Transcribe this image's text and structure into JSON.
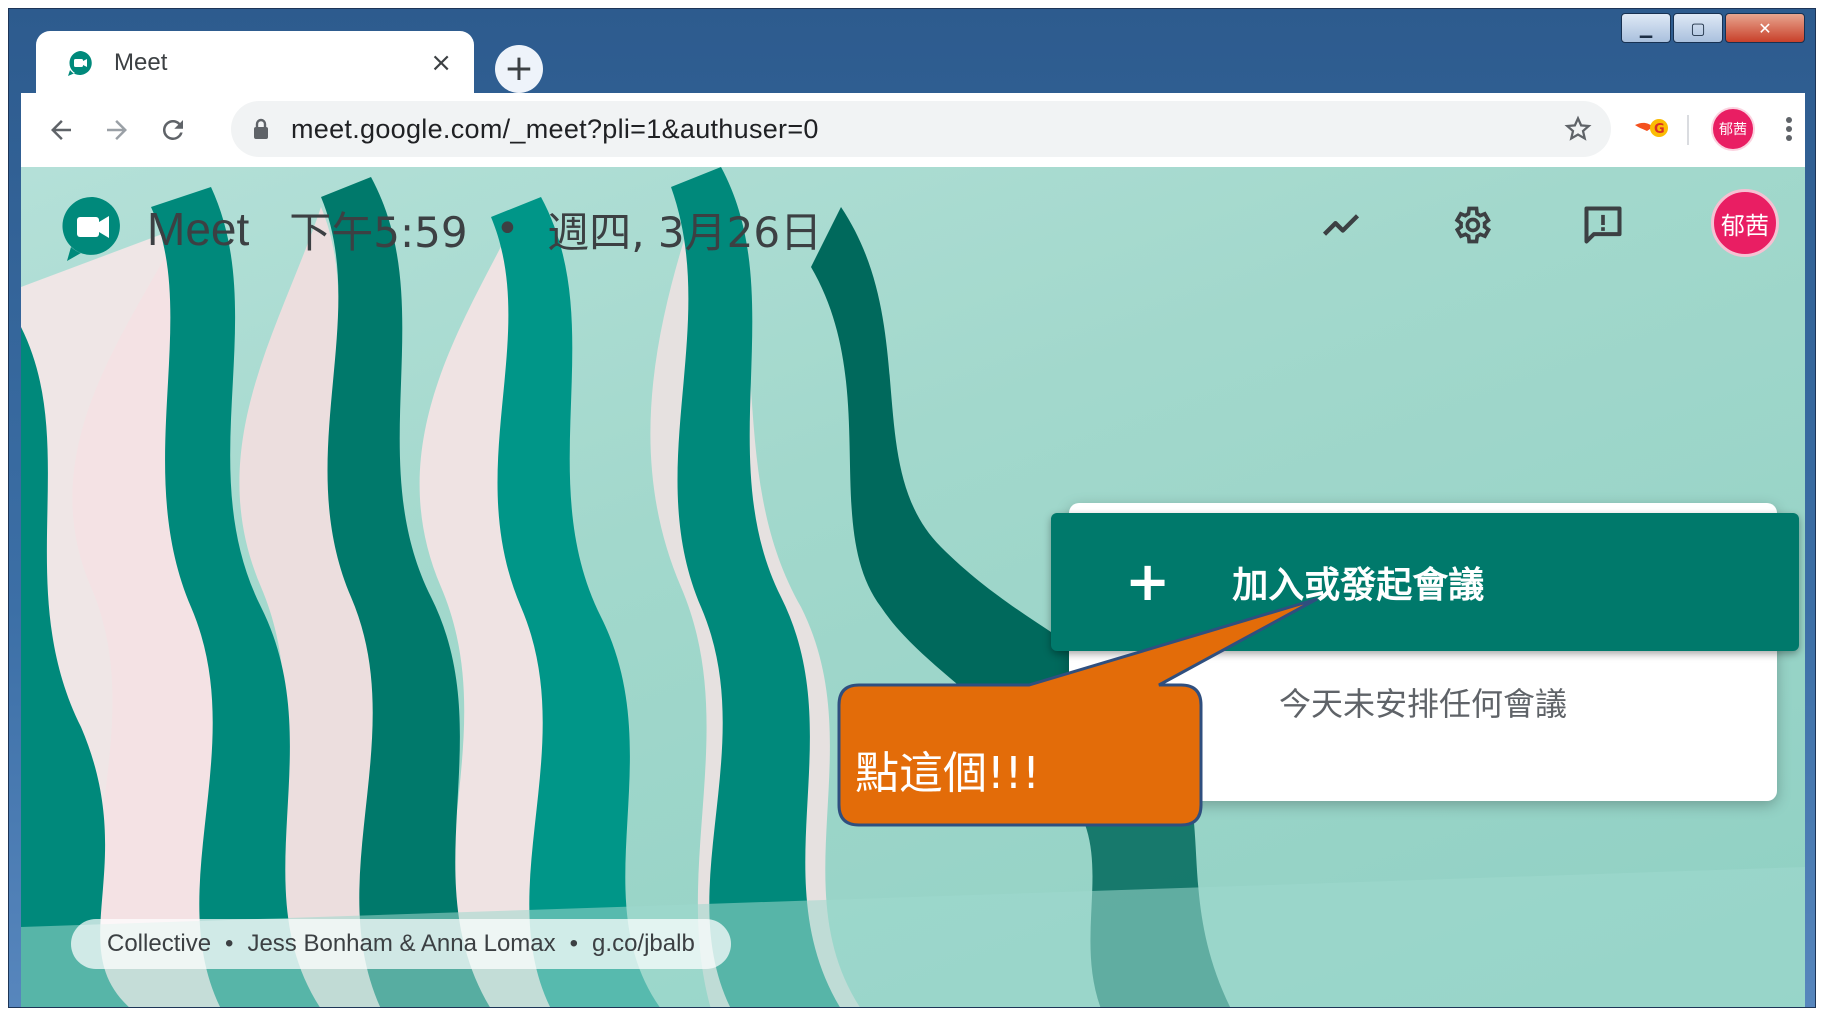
{
  "browser": {
    "tab_title": "Meet",
    "tab_close": "×",
    "new_tab": "+",
    "url": "meet.google.com/_meet?pli=1&authuser=0",
    "profile_initials": "郁茜"
  },
  "meet": {
    "brand": "Meet",
    "time": "下午5:59",
    "separator": "•",
    "date": "週四, 3月26日",
    "avatar_initials": "郁茜",
    "join_button_plus": "+",
    "join_button_label": "加入或發起會議",
    "no_meetings_text": "今天未安排任何會議"
  },
  "credit": {
    "collection": "Collective",
    "artists": "Jess Bonham & Anna Lomax",
    "link": "g.co/jbalb",
    "separator": "•"
  },
  "annotation": {
    "callout_text": "點這個!!!",
    "color": "#e36c09"
  },
  "colors": {
    "meet_green": "#00796b",
    "avatar_pink": "#e91e63"
  },
  "icons": {
    "back": "back-arrow-icon",
    "forward": "forward-arrow-icon",
    "reload": "reload-icon",
    "lock": "lock-icon",
    "star": "star-icon",
    "extension": "extension-icon",
    "menu": "more-vert-icon",
    "trend": "trend-icon",
    "settings": "gear-icon",
    "feedback": "feedback-icon"
  }
}
